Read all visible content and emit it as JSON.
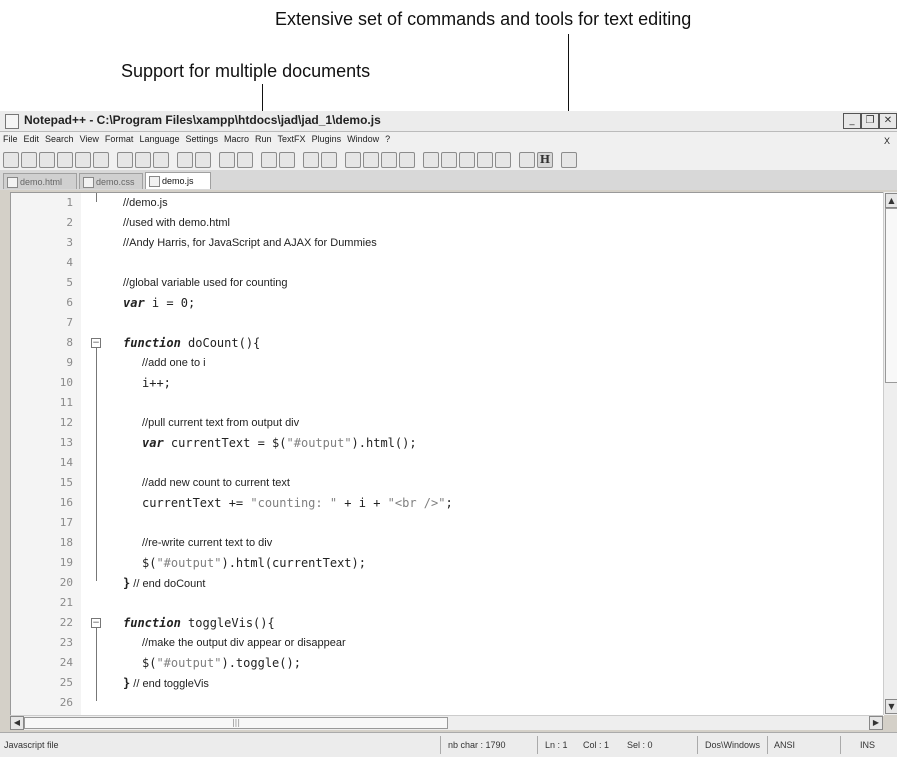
{
  "callouts": {
    "top": "Extensive set of commands and tools for text editing",
    "left": "Support for multiple documents"
  },
  "window": {
    "title": "Notepad++ - C:\\Program Files\\xampp\\htdocs\\jad\\jad_1\\demo.js",
    "buttons": [
      "_",
      "❐",
      "✕"
    ]
  },
  "menu": [
    "File",
    "Edit",
    "Search",
    "View",
    "Format",
    "Language",
    "Settings",
    "Macro",
    "Run",
    "TextFX",
    "Plugins",
    "Window",
    "?"
  ],
  "menu_close": "X",
  "toolbar_bold_glyph": "H",
  "tabs": [
    "demo.html",
    "demo.css",
    "demo.js"
  ],
  "code_lines": [
    {
      "n": "1",
      "text": "//demo.js"
    },
    {
      "n": "2",
      "text": "//used with demo.html"
    },
    {
      "n": "3",
      "text": "//Andy Harris, for JavaScript and AJAX for Dummies"
    },
    {
      "n": "4",
      "text": ""
    },
    {
      "n": "5",
      "text": "//global variable used for counting"
    },
    {
      "n": "6",
      "kw": "var",
      "rest": " i = 0;"
    },
    {
      "n": "7",
      "text": ""
    },
    {
      "n": "8",
      "kw": "function",
      "rest": " doCount(){"
    },
    {
      "n": "9",
      "text": "//add one to i"
    },
    {
      "n": "10",
      "rest": "i++;"
    },
    {
      "n": "11",
      "text": ""
    },
    {
      "n": "12",
      "text": "//pull current text from output div"
    },
    {
      "n": "13",
      "kw": "var",
      "rest": " currentText = $(",
      "str": "\"#output\"",
      "tail": ").html();"
    },
    {
      "n": "14",
      "text": ""
    },
    {
      "n": "15",
      "text": "//add new count to current text"
    },
    {
      "n": "16",
      "rest": "currentText += ",
      "str": "\"counting: \"",
      "tail": " + i + ",
      "str2": "\"<br />\"",
      "tail2": ";"
    },
    {
      "n": "17",
      "text": ""
    },
    {
      "n": "18",
      "text": "//re-write current text to div"
    },
    {
      "n": "19",
      "rest": "$(",
      "str": "\"#output\"",
      "tail": ").html(currentText);"
    },
    {
      "n": "20",
      "brace": "}",
      "text": " // end doCount"
    },
    {
      "n": "21",
      "text": ""
    },
    {
      "n": "22",
      "kw": "function",
      "rest": " toggleVis(){"
    },
    {
      "n": "23",
      "text": "//make the output div appear or disappear"
    },
    {
      "n": "24",
      "rest": "$(",
      "str": "\"#output\"",
      "tail": ").toggle();"
    },
    {
      "n": "25",
      "brace": "}",
      "text": " // end toggleVis"
    },
    {
      "n": "26",
      "text": ""
    }
  ],
  "scroll_glyphs": {
    "up": "▲",
    "down": "▼",
    "left": "◀",
    "right": "▶",
    "grip": "|||"
  },
  "status": {
    "type": "Javascript file",
    "chars": "nb char : 1790",
    "ln": "Ln : 1",
    "col": "Col : 1",
    "sel": "Sel : 0",
    "eol": "Dos\\Windows",
    "enc": "ANSI",
    "mode": "INS"
  }
}
